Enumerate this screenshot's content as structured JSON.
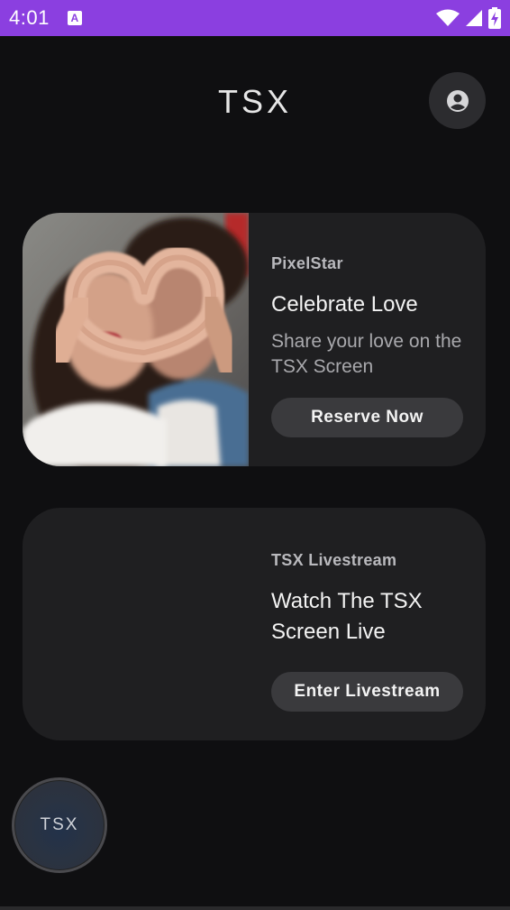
{
  "status_bar": {
    "time": "4:01",
    "notification_icon": "a-box-icon",
    "icons": [
      "wifi-icon",
      "signal-icon",
      "battery-charging-icon"
    ],
    "color": "#8b3fe0"
  },
  "header": {
    "title": "TSX",
    "profile_icon": "account-circle-icon"
  },
  "cards": [
    {
      "tag": "PixelStar",
      "title": "Celebrate Love",
      "description": "Share your love on the TSX Screen",
      "button": "Reserve Now",
      "image": "couple-heart-hands-photo"
    },
    {
      "tag": "TSX Livestream",
      "title": "Watch The TSX Screen Live",
      "button": "Enter Livestream"
    }
  ],
  "fab": {
    "label": "TSX"
  },
  "colors": {
    "background": "#0f0f11",
    "card": "#1f1f21",
    "button": "#3a3a3d"
  }
}
